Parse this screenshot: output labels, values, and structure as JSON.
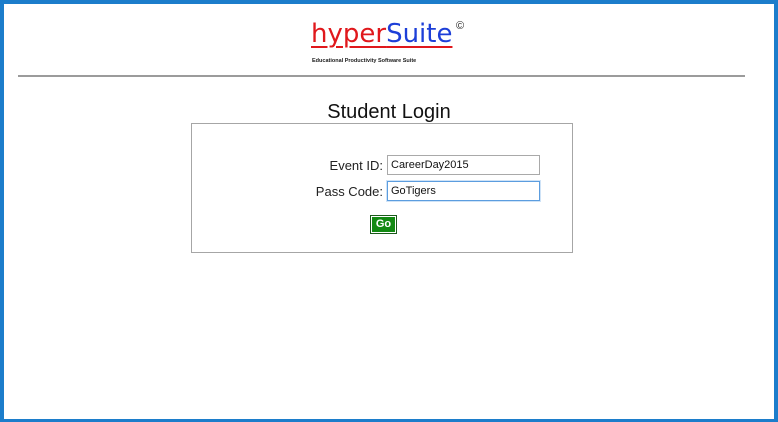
{
  "header": {
    "logo": {
      "part1": "hyper",
      "part2": "Suite",
      "mark": "©",
      "tagline": "Educational Productivity Software Suite"
    }
  },
  "main": {
    "title": "Student Login",
    "form": {
      "event_id_label": "Event ID:",
      "event_id_value": "CareerDay2015",
      "pass_code_label": "Pass Code:",
      "pass_code_value": "GoTigers",
      "submit_label": "Go"
    }
  },
  "colors": {
    "frame_border": "#1c7dcb",
    "logo_red": "#e0181c",
    "logo_blue": "#1d3fd8",
    "go_button": "#128a12",
    "focus_border": "#5c9ddf"
  }
}
